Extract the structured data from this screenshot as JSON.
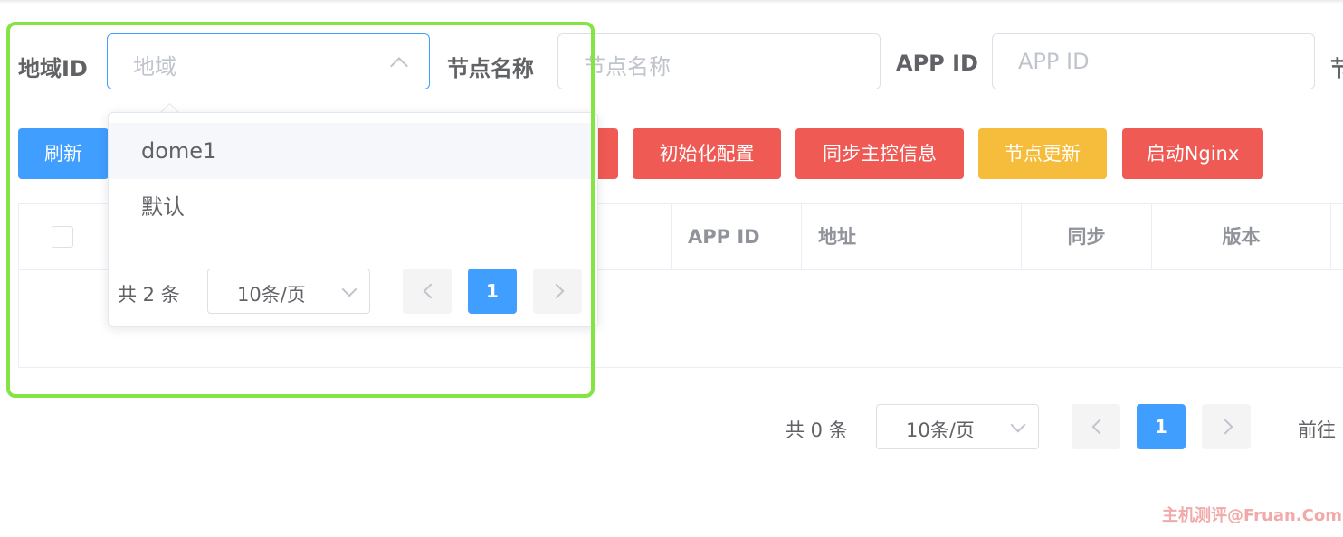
{
  "filters": {
    "region_label": "地域ID",
    "region_placeholder": "地域",
    "node_name_label": "节点名称",
    "node_name_placeholder": "节点名称",
    "app_id_label": "APP ID",
    "app_id_placeholder": "APP ID",
    "cut_label": "节"
  },
  "toolbar": {
    "refresh": "刷新",
    "init_config": "初始化配置",
    "sync_master": "同步主控信息",
    "node_update": "节点更新",
    "start_nginx": "启动Nginx"
  },
  "table": {
    "columns": [
      "APP ID",
      "地址",
      "同步",
      "版本"
    ]
  },
  "dropdown": {
    "options": [
      "dome1",
      "默认"
    ],
    "total": "共 2 条",
    "page_size": "10条/页",
    "current_page": "1"
  },
  "pagination": {
    "total": "共 0 条",
    "page_size": "10条/页",
    "current_page": "1",
    "goto": "前往"
  },
  "colors": {
    "primary": "#409eff",
    "danger": "#f05a55",
    "warning": "#f5bd3b",
    "highlight": "#84e444"
  },
  "watermark": "主机测评@Fruan.Com"
}
